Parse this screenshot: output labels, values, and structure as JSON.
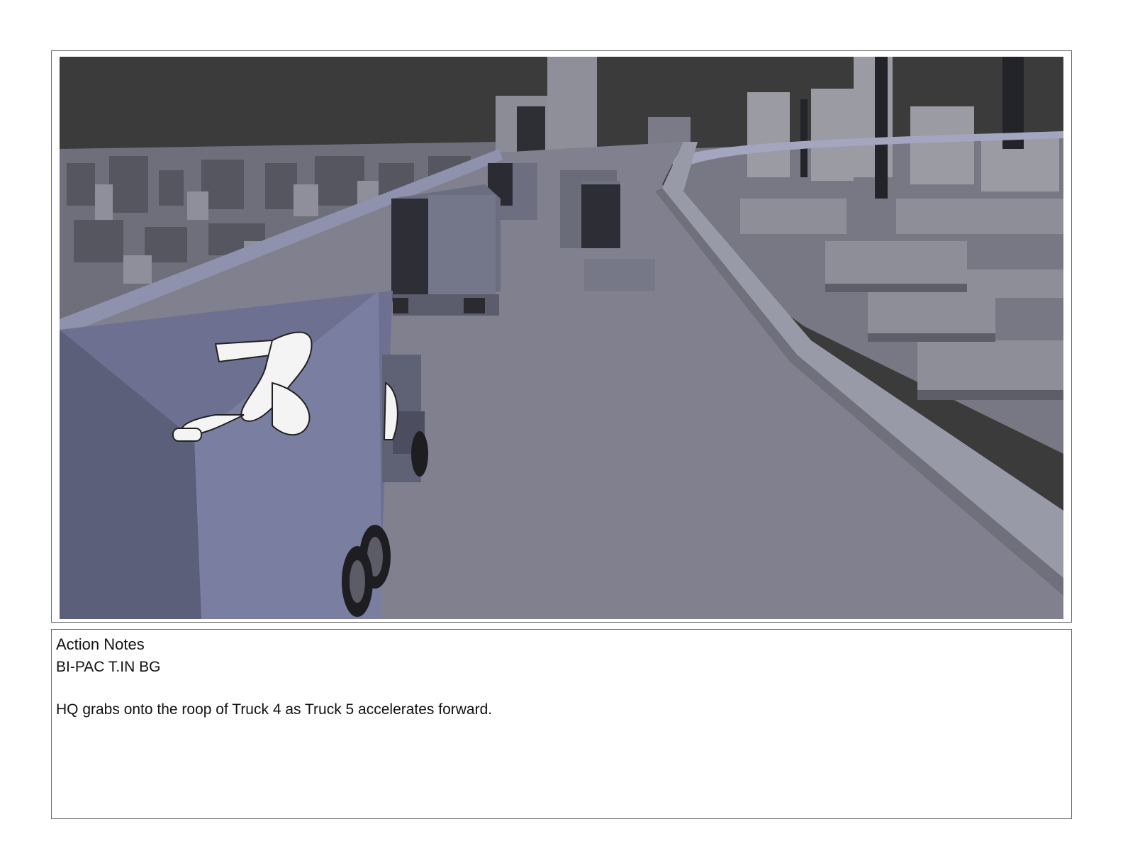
{
  "storyboard_panel": {
    "image_alt": "",
    "colors": {
      "sky": "#3b3b3b",
      "road": "#80808f",
      "truck_body": "#6f7390",
      "building_light": "#8c8c96",
      "building_dark": "#4b4c56",
      "figure_sketch": "#ffffff"
    }
  },
  "notes": {
    "heading": "Action Notes",
    "shot_code": "BI-PAC T.IN BG",
    "description": "HQ grabs onto the roop of Truck 4 as Truck 5 accelerates forward."
  }
}
